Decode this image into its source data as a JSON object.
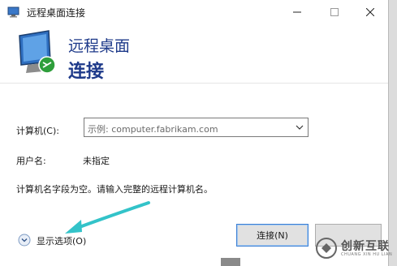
{
  "window": {
    "title": "远程桌面连接",
    "controls": {
      "minimize_icon": "minimize-icon",
      "maximize_icon": "maximize-icon",
      "close_icon": "close-icon"
    }
  },
  "header": {
    "line1": "远程桌面",
    "line2": "连接",
    "title_color": "#1e3a8a"
  },
  "form": {
    "computer_label": "计算机(C):",
    "computer_placeholder": "示例: computer.fabrikam.com",
    "user_label": "用户名:",
    "user_value": "未指定",
    "message": "计算机名字段为空。请输入完整的远程计算机名。"
  },
  "footer": {
    "show_options_label": "显示选项(O)",
    "connect_label": "连接(N)"
  },
  "annotation": {
    "arrow_color": "#33c3c9"
  },
  "watermark": {
    "text": "创新互联",
    "sub": "CHUANG XIN HU LIAN"
  }
}
